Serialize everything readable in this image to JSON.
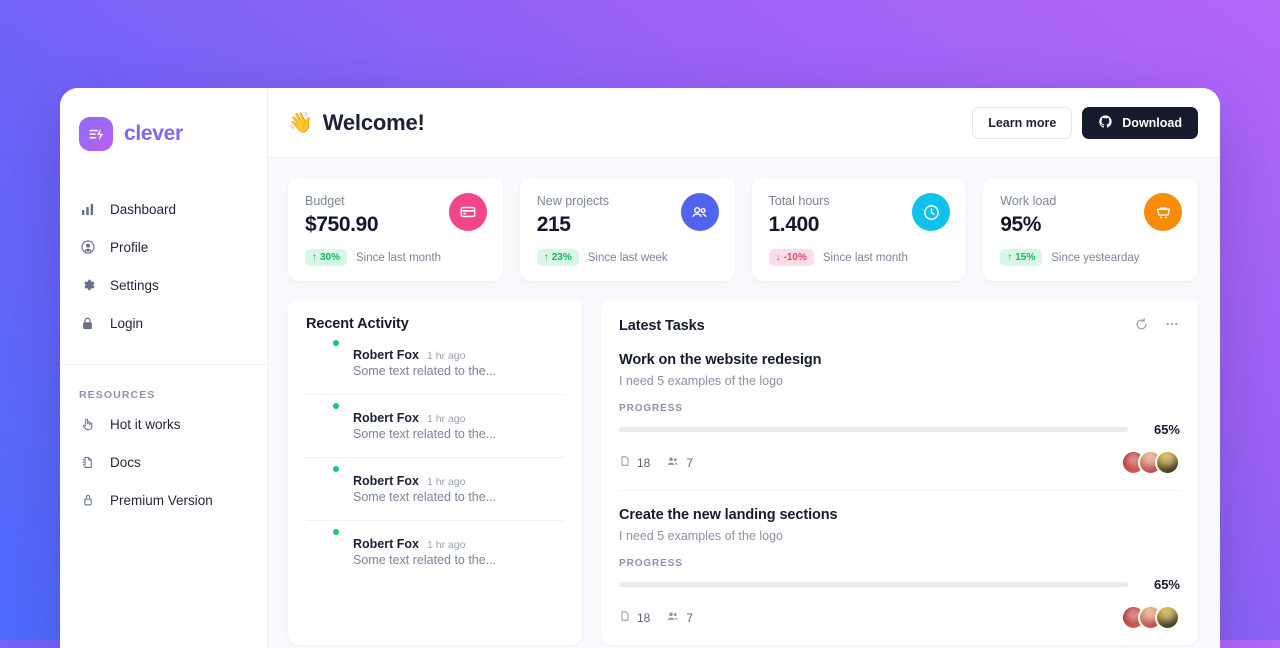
{
  "brand": {
    "name": "clever",
    "icon": "bolt-lines-logo-icon"
  },
  "sidebar": {
    "nav": [
      {
        "label": "Dashboard",
        "icon": "bar-chart-icon"
      },
      {
        "label": "Profile",
        "icon": "user-circle-icon"
      },
      {
        "label": "Settings",
        "icon": "gear-icon"
      },
      {
        "label": "Login",
        "icon": "lock-icon"
      }
    ],
    "resources_title": "RESOURCES",
    "resources": [
      {
        "label": "Hot it works",
        "icon": "hand-pointer-icon"
      },
      {
        "label": "Docs",
        "icon": "document-icon"
      },
      {
        "label": "Premium Version",
        "icon": "padlock-icon"
      }
    ]
  },
  "topbar": {
    "wave_emoji": "👋",
    "title": "Welcome!",
    "learn_more_label": "Learn more",
    "download_label": "Download",
    "download_icon": "github-icon"
  },
  "stats": [
    {
      "label": "Budget",
      "value": "$750.90",
      "delta": "30%",
      "delta_arrow": "↑",
      "direction": "up",
      "since": "Since last month",
      "icon": "credit-card-icon",
      "color": "#f3468a"
    },
    {
      "label": "New projects",
      "value": "215",
      "delta": "23%",
      "delta_arrow": "↑",
      "direction": "up",
      "since": "Since last week",
      "icon": "users-icon",
      "color": "#5164ef"
    },
    {
      "label": "Total hours",
      "value": "1.400",
      "delta": "-10%",
      "delta_arrow": "↓",
      "direction": "down",
      "since": "Since last month",
      "icon": "clock-icon",
      "color": "#0fc2ec"
    },
    {
      "label": "Work load",
      "value": "95%",
      "delta": "15%",
      "delta_arrow": "↑",
      "direction": "up",
      "since": "Since yestearday",
      "icon": "shopping-cart-icon",
      "color": "#f98b06"
    }
  ],
  "activity_panel": {
    "title": "Recent Activity",
    "items": [
      {
        "name": "Robert Fox",
        "time": "1 hr ago",
        "text": "Some text related to the...",
        "avatar_a": "#8d2f2c",
        "avatar_b": "#e06a56",
        "status": "online"
      },
      {
        "name": "Robert Fox",
        "time": "1 hr ago",
        "text": "Some text related to the...",
        "avatar_a": "#e4a0ad",
        "avatar_b": "#2d4a6b",
        "status": "online"
      },
      {
        "name": "Robert Fox",
        "time": "1 hr ago",
        "text": "Some text related to the...",
        "avatar_a": "#c33a4e",
        "avatar_b": "#e8b98c",
        "status": "online"
      },
      {
        "name": "Robert Fox",
        "time": "1 hr ago",
        "text": "Some text related to the...",
        "avatar_a": "#f0c22a",
        "avatar_b": "#2b2b2b",
        "status": "online"
      }
    ]
  },
  "tasks_panel": {
    "title": "Latest Tasks",
    "refresh_icon": "refresh-icon",
    "more_icon": "ellipsis-icon",
    "progress_label": "PROGRESS",
    "files_icon": "file-icon",
    "members_icon": "people-icon",
    "tasks": [
      {
        "title": "Work on the website redesign",
        "subtitle": "I need 5 examples of the logo",
        "progress": 65,
        "progress_text": "65%",
        "bar_color": "#5b4ef0",
        "files": "18",
        "members": "7",
        "team": [
          {
            "a": "#b0262f",
            "b": "#e6725c"
          },
          {
            "a": "#e8b070",
            "b": "#c74a5c"
          },
          {
            "a": "#f0c22a",
            "b": "#2b2b2b"
          }
        ]
      },
      {
        "title": "Create the new landing sections",
        "subtitle": "I need 5 examples of the logo",
        "progress": 65,
        "progress_text": "65%",
        "bar_color": "#f23d72",
        "files": "18",
        "members": "7",
        "team": [
          {
            "a": "#b0262f",
            "b": "#e6725c"
          },
          {
            "a": "#e8b070",
            "b": "#c74a5c"
          },
          {
            "a": "#f0c22a",
            "b": "#2b2b2b"
          }
        ]
      }
    ]
  }
}
